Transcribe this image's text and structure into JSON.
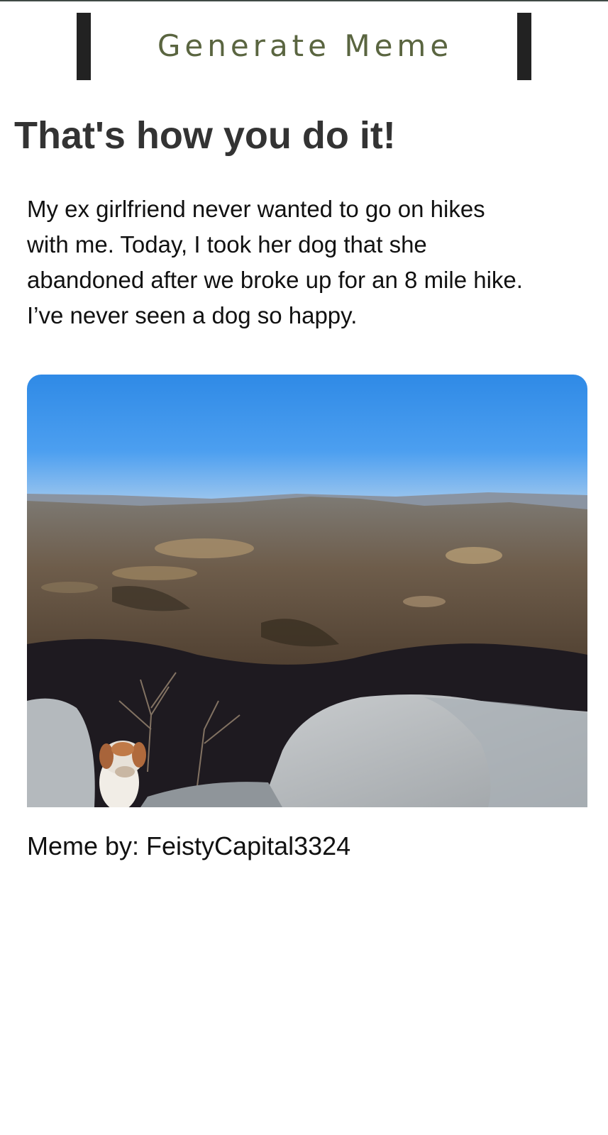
{
  "header": {
    "button_label": "Generate Meme"
  },
  "meme": {
    "title": "That's how you do it!",
    "text": "My ex girlfriend never wanted to go on hikes\nwith me. Today, I took her dog that she\nabandoned after we broke up for an 8 mile hike.\nI’ve never seen a dog so happy.",
    "author_line": "Meme by: FeistyCapital3324"
  }
}
